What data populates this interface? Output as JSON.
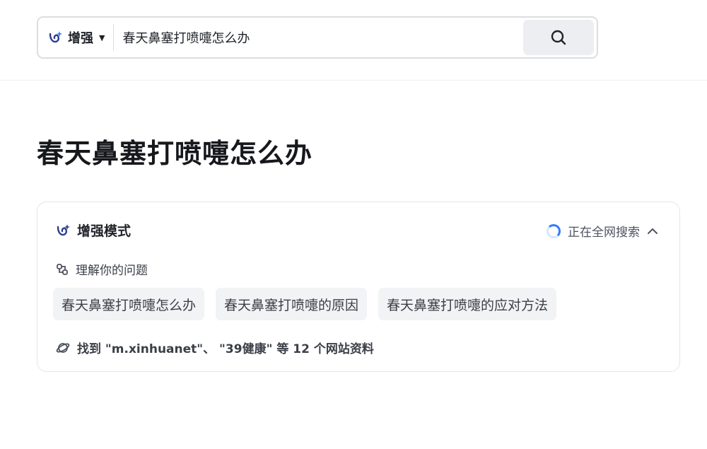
{
  "search": {
    "mode_label": "增强",
    "query": "春天鼻塞打喷嚏怎么办"
  },
  "page": {
    "title": "春天鼻塞打喷嚏怎么办"
  },
  "card": {
    "mode_name": "增强模式",
    "status": "正在全网搜索",
    "understand_label": "理解你的问题",
    "queries": [
      {
        "label": "春天鼻塞打喷嚏怎么办"
      },
      {
        "label": "春天鼻塞打喷嚏的原因"
      },
      {
        "label": "春天鼻塞打喷嚏的应对方法"
      }
    ],
    "found_text": "找到 \"m.xinhuanet\"、 \"39健康\" 等 12 个网站资料"
  },
  "colors": {
    "accent": "#2f7bff",
    "icon_dark": "#2b3d8f"
  }
}
